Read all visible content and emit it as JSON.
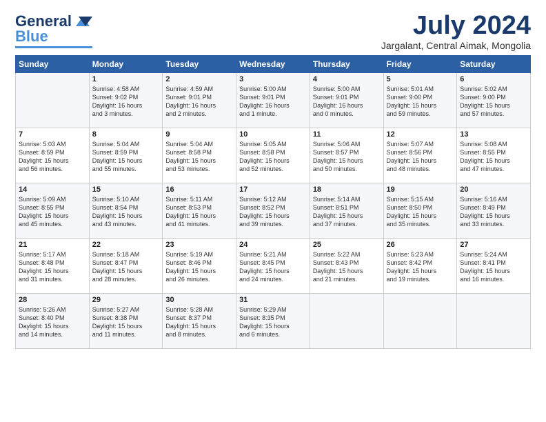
{
  "header": {
    "logo_line1": "General",
    "logo_line1_colored": "Blue",
    "month_year": "July 2024",
    "location": "Jargalant, Central Aimak, Mongolia"
  },
  "weekdays": [
    "Sunday",
    "Monday",
    "Tuesday",
    "Wednesday",
    "Thursday",
    "Friday",
    "Saturday"
  ],
  "weeks": [
    [
      {
        "day": "",
        "info": ""
      },
      {
        "day": "1",
        "info": "Sunrise: 4:58 AM\nSunset: 9:02 PM\nDaylight: 16 hours\nand 3 minutes."
      },
      {
        "day": "2",
        "info": "Sunrise: 4:59 AM\nSunset: 9:01 PM\nDaylight: 16 hours\nand 2 minutes."
      },
      {
        "day": "3",
        "info": "Sunrise: 5:00 AM\nSunset: 9:01 PM\nDaylight: 16 hours\nand 1 minute."
      },
      {
        "day": "4",
        "info": "Sunrise: 5:00 AM\nSunset: 9:01 PM\nDaylight: 16 hours\nand 0 minutes."
      },
      {
        "day": "5",
        "info": "Sunrise: 5:01 AM\nSunset: 9:00 PM\nDaylight: 15 hours\nand 59 minutes."
      },
      {
        "day": "6",
        "info": "Sunrise: 5:02 AM\nSunset: 9:00 PM\nDaylight: 15 hours\nand 57 minutes."
      }
    ],
    [
      {
        "day": "7",
        "info": "Sunrise: 5:03 AM\nSunset: 8:59 PM\nDaylight: 15 hours\nand 56 minutes."
      },
      {
        "day": "8",
        "info": "Sunrise: 5:04 AM\nSunset: 8:59 PM\nDaylight: 15 hours\nand 55 minutes."
      },
      {
        "day": "9",
        "info": "Sunrise: 5:04 AM\nSunset: 8:58 PM\nDaylight: 15 hours\nand 53 minutes."
      },
      {
        "day": "10",
        "info": "Sunrise: 5:05 AM\nSunset: 8:58 PM\nDaylight: 15 hours\nand 52 minutes."
      },
      {
        "day": "11",
        "info": "Sunrise: 5:06 AM\nSunset: 8:57 PM\nDaylight: 15 hours\nand 50 minutes."
      },
      {
        "day": "12",
        "info": "Sunrise: 5:07 AM\nSunset: 8:56 PM\nDaylight: 15 hours\nand 48 minutes."
      },
      {
        "day": "13",
        "info": "Sunrise: 5:08 AM\nSunset: 8:55 PM\nDaylight: 15 hours\nand 47 minutes."
      }
    ],
    [
      {
        "day": "14",
        "info": "Sunrise: 5:09 AM\nSunset: 8:55 PM\nDaylight: 15 hours\nand 45 minutes."
      },
      {
        "day": "15",
        "info": "Sunrise: 5:10 AM\nSunset: 8:54 PM\nDaylight: 15 hours\nand 43 minutes."
      },
      {
        "day": "16",
        "info": "Sunrise: 5:11 AM\nSunset: 8:53 PM\nDaylight: 15 hours\nand 41 minutes."
      },
      {
        "day": "17",
        "info": "Sunrise: 5:12 AM\nSunset: 8:52 PM\nDaylight: 15 hours\nand 39 minutes."
      },
      {
        "day": "18",
        "info": "Sunrise: 5:14 AM\nSunset: 8:51 PM\nDaylight: 15 hours\nand 37 minutes."
      },
      {
        "day": "19",
        "info": "Sunrise: 5:15 AM\nSunset: 8:50 PM\nDaylight: 15 hours\nand 35 minutes."
      },
      {
        "day": "20",
        "info": "Sunrise: 5:16 AM\nSunset: 8:49 PM\nDaylight: 15 hours\nand 33 minutes."
      }
    ],
    [
      {
        "day": "21",
        "info": "Sunrise: 5:17 AM\nSunset: 8:48 PM\nDaylight: 15 hours\nand 31 minutes."
      },
      {
        "day": "22",
        "info": "Sunrise: 5:18 AM\nSunset: 8:47 PM\nDaylight: 15 hours\nand 28 minutes."
      },
      {
        "day": "23",
        "info": "Sunrise: 5:19 AM\nSunset: 8:46 PM\nDaylight: 15 hours\nand 26 minutes."
      },
      {
        "day": "24",
        "info": "Sunrise: 5:21 AM\nSunset: 8:45 PM\nDaylight: 15 hours\nand 24 minutes."
      },
      {
        "day": "25",
        "info": "Sunrise: 5:22 AM\nSunset: 8:43 PM\nDaylight: 15 hours\nand 21 minutes."
      },
      {
        "day": "26",
        "info": "Sunrise: 5:23 AM\nSunset: 8:42 PM\nDaylight: 15 hours\nand 19 minutes."
      },
      {
        "day": "27",
        "info": "Sunrise: 5:24 AM\nSunset: 8:41 PM\nDaylight: 15 hours\nand 16 minutes."
      }
    ],
    [
      {
        "day": "28",
        "info": "Sunrise: 5:26 AM\nSunset: 8:40 PM\nDaylight: 15 hours\nand 14 minutes."
      },
      {
        "day": "29",
        "info": "Sunrise: 5:27 AM\nSunset: 8:38 PM\nDaylight: 15 hours\nand 11 minutes."
      },
      {
        "day": "30",
        "info": "Sunrise: 5:28 AM\nSunset: 8:37 PM\nDaylight: 15 hours\nand 8 minutes."
      },
      {
        "day": "31",
        "info": "Sunrise: 5:29 AM\nSunset: 8:35 PM\nDaylight: 15 hours\nand 6 minutes."
      },
      {
        "day": "",
        "info": ""
      },
      {
        "day": "",
        "info": ""
      },
      {
        "day": "",
        "info": ""
      }
    ]
  ]
}
